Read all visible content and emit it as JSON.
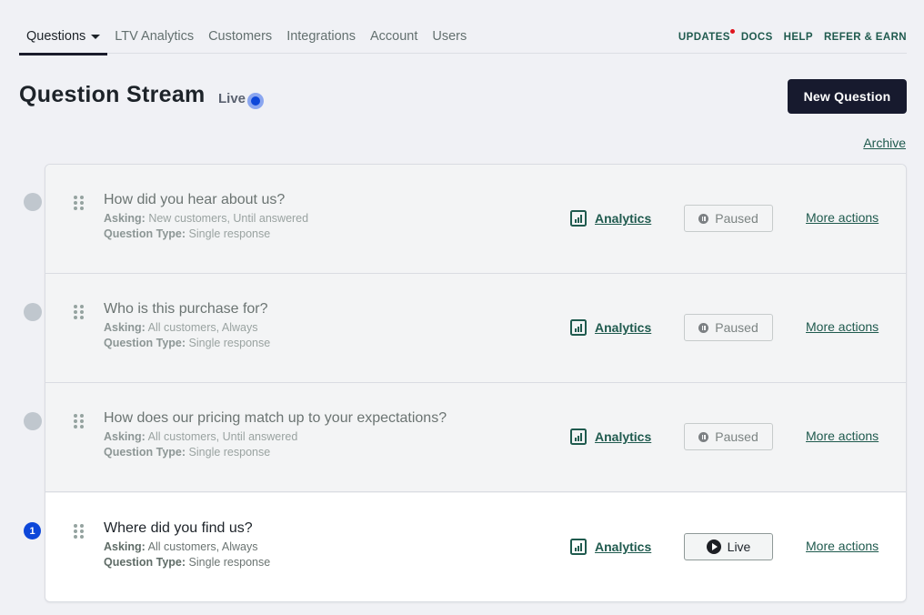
{
  "nav": {
    "tabs": [
      {
        "label": "Questions",
        "active": true,
        "has_dropdown": true
      },
      {
        "label": "LTV Analytics"
      },
      {
        "label": "Customers"
      },
      {
        "label": "Integrations"
      },
      {
        "label": "Account"
      },
      {
        "label": "Users"
      }
    ],
    "links": [
      {
        "label": "UPDATES",
        "has_notification": true
      },
      {
        "label": "DOCS"
      },
      {
        "label": "HELP"
      },
      {
        "label": "REFER & EARN"
      }
    ]
  },
  "header": {
    "title": "Question Stream",
    "live_label": "Live",
    "new_button": "New Question",
    "archive_link": "Archive"
  },
  "questions": [
    {
      "title": "How did you hear about us?",
      "asking_label": "Asking:",
      "asking": "New customers, Until answered",
      "type_label": "Question Type:",
      "type": "Single response",
      "analytics": "Analytics",
      "status": "Paused",
      "more": "More actions",
      "indicator": ""
    },
    {
      "title": "Who is this purchase for?",
      "asking_label": "Asking:",
      "asking": "All customers, Always",
      "type_label": "Question Type:",
      "type": "Single response",
      "analytics": "Analytics",
      "status": "Paused",
      "more": "More actions",
      "indicator": ""
    },
    {
      "title": "How does our pricing match up to your expectations?",
      "asking_label": "Asking:",
      "asking": "All customers, Until answered",
      "type_label": "Question Type:",
      "type": "Single response",
      "analytics": "Analytics",
      "status": "Paused",
      "more": "More actions",
      "indicator": ""
    },
    {
      "title": "Where did you find us?",
      "asking_label": "Asking:",
      "asking": "All customers, Always",
      "type_label": "Question Type:",
      "type": "Single response",
      "analytics": "Analytics",
      "status": "Live",
      "more": "More actions",
      "indicator": "1"
    }
  ],
  "colors": {
    "accent_green": "#1f5a4e",
    "primary_button": "#171a2e",
    "live_blue": "#0d47d9",
    "notification_red": "#e0141e"
  }
}
